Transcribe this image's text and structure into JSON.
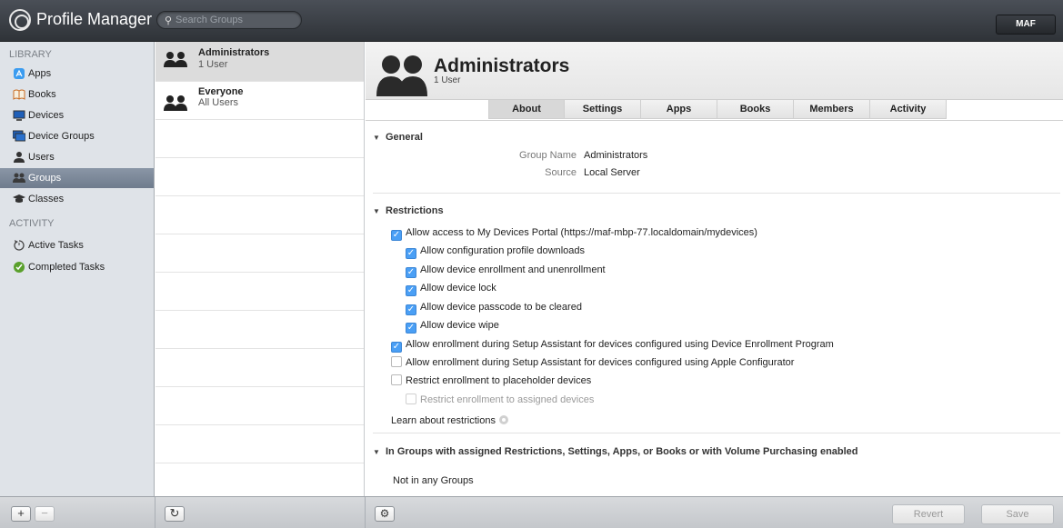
{
  "app": {
    "title": "Profile Manager",
    "user": "MAF"
  },
  "search": {
    "placeholder": "Search Groups"
  },
  "sidebar": {
    "library_label": "LIBRARY",
    "activity_label": "ACTIVITY",
    "library_items": [
      {
        "label": "Apps",
        "icon": "apps-icon"
      },
      {
        "label": "Books",
        "icon": "books-icon"
      },
      {
        "label": "Devices",
        "icon": "devices-icon"
      },
      {
        "label": "Device Groups",
        "icon": "device-groups-icon"
      },
      {
        "label": "Users",
        "icon": "user-icon"
      },
      {
        "label": "Groups",
        "icon": "groups-icon",
        "selected": true
      },
      {
        "label": "Classes",
        "icon": "classes-icon"
      }
    ],
    "activity_items": [
      {
        "label": "Active Tasks",
        "icon": "active-tasks-icon"
      },
      {
        "label": "Completed Tasks",
        "icon": "completed-tasks-icon"
      }
    ]
  },
  "groups": [
    {
      "name": "Administrators",
      "sub": "1 User",
      "selected": true
    },
    {
      "name": "Everyone",
      "sub": "All Users"
    }
  ],
  "detail": {
    "title": "Administrators",
    "subtitle": "1 User",
    "tabs": [
      "About",
      "Settings",
      "Apps",
      "Books",
      "Members",
      "Activity"
    ],
    "active_tab": "About",
    "general": {
      "heading": "General",
      "rows": [
        {
          "label": "Group Name",
          "value": "Administrators"
        },
        {
          "label": "Source",
          "value": "Local Server"
        }
      ]
    },
    "restrictions": {
      "heading": "Restrictions",
      "items": [
        {
          "label": "Allow access to My Devices Portal (https://maf-mbp-77.localdomain/mydevices)",
          "checked": true,
          "indent": 0,
          "disabled": false
        },
        {
          "label": "Allow configuration profile downloads",
          "checked": true,
          "indent": 1,
          "disabled": false
        },
        {
          "label": "Allow device enrollment and unenrollment",
          "checked": true,
          "indent": 1,
          "disabled": false
        },
        {
          "label": "Allow device lock",
          "checked": true,
          "indent": 1,
          "disabled": false
        },
        {
          "label": "Allow device passcode to be cleared",
          "checked": true,
          "indent": 1,
          "disabled": false
        },
        {
          "label": "Allow device wipe",
          "checked": true,
          "indent": 1,
          "disabled": false
        },
        {
          "label": "Allow enrollment during Setup Assistant for devices configured using Device Enrollment Program",
          "checked": true,
          "indent": 0,
          "disabled": false
        },
        {
          "label": "Allow enrollment during Setup Assistant for devices configured using Apple Configurator",
          "checked": false,
          "indent": 0,
          "disabled": false
        },
        {
          "label": "Restrict enrollment to placeholder devices",
          "checked": false,
          "indent": 0,
          "disabled": false
        },
        {
          "label": "Restrict enrollment to assigned devices",
          "checked": false,
          "indent": 1,
          "disabled": true
        }
      ],
      "learn_more": "Learn about restrictions"
    },
    "in_groups": {
      "heading": "In Groups with assigned Restrictions, Settings, Apps, or Books or with Volume Purchasing enabled",
      "value": "Not in any Groups"
    }
  },
  "bottombar": {
    "add_label": "+",
    "remove_label": "−",
    "refresh_label": "↻",
    "gear_label": "⚙",
    "revert_label": "Revert",
    "save_label": "Save"
  }
}
